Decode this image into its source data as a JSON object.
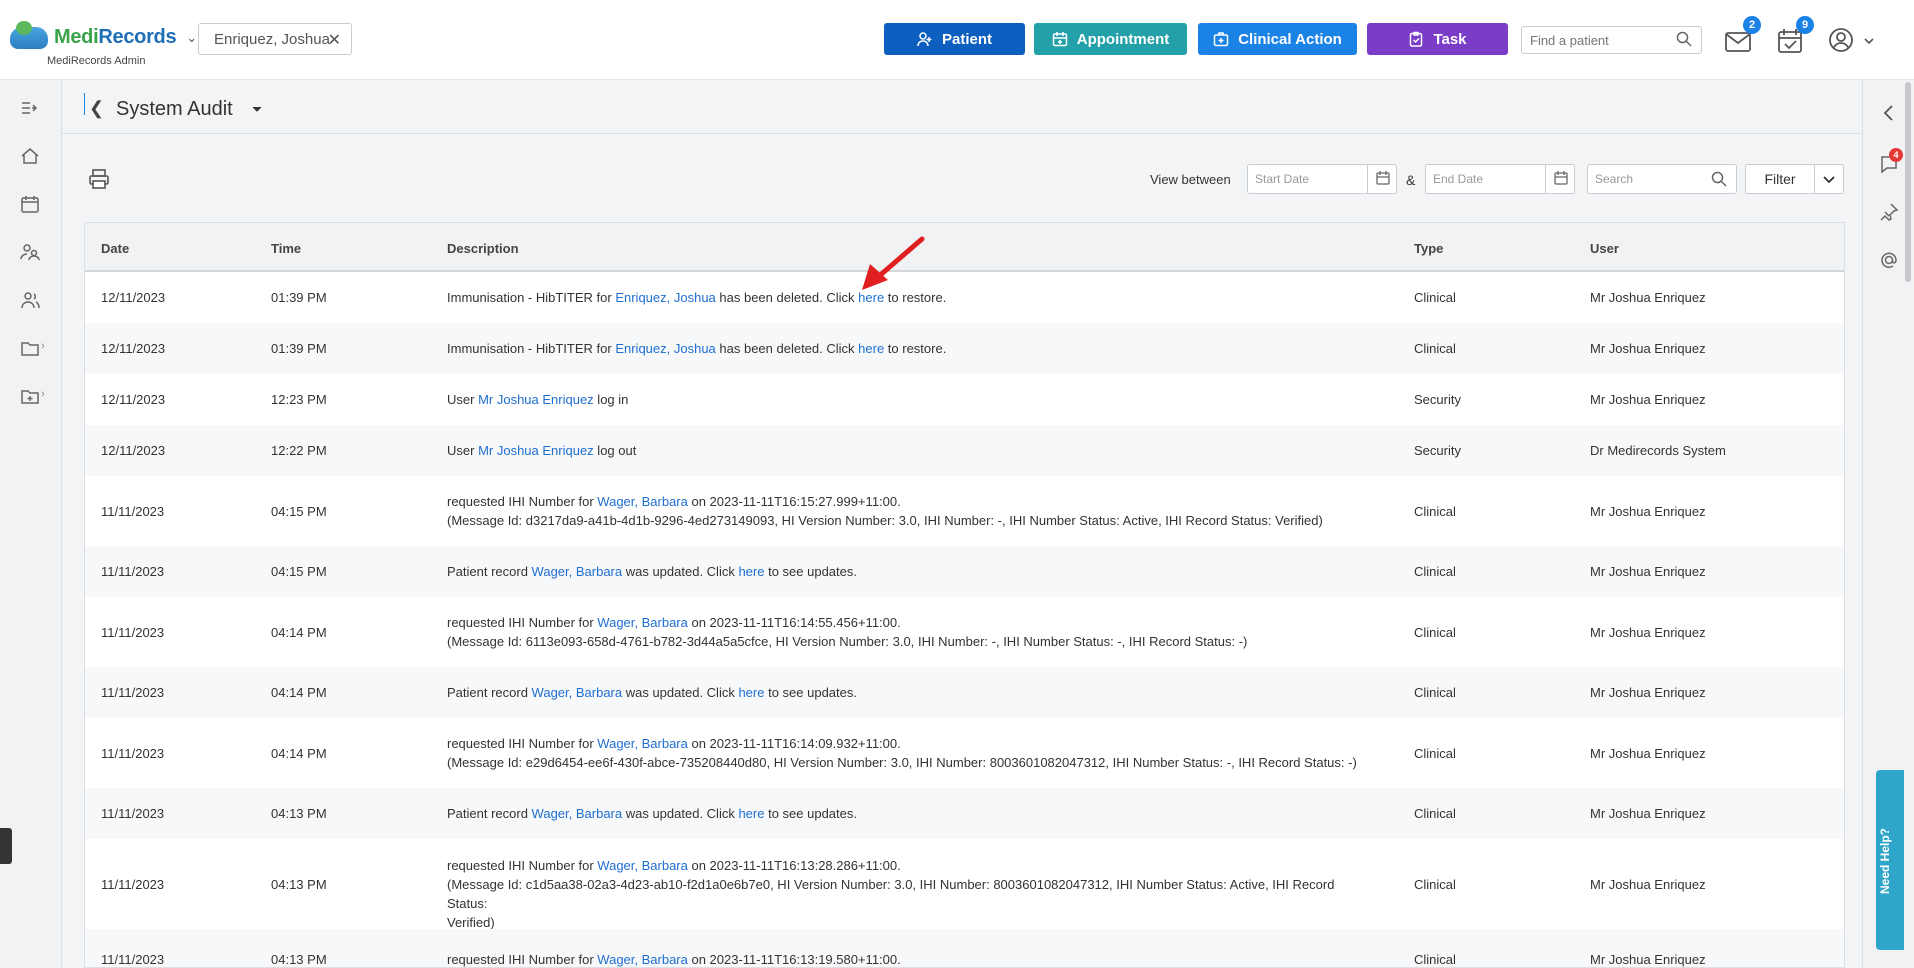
{
  "header": {
    "logo_medi": "Medi",
    "logo_records": "Records",
    "logo_sub": "MediRecords Admin",
    "patient_chip": "Enriquez, Joshua",
    "buttons": {
      "patient": "Patient",
      "appointment": "Appointment",
      "clinical_action": "Clinical Action",
      "task": "Task"
    },
    "find_placeholder": "Find a patient",
    "mail_badge": "2",
    "tasks_badge": "9",
    "colors": {
      "patient": "#0d5fbf",
      "appointment": "#23a0a8",
      "clinical_action": "#1b82e6",
      "task": "#7b3cc8"
    }
  },
  "page": {
    "title": "System Audit",
    "view_between": "View between",
    "start_placeholder": "Start Date",
    "end_placeholder": "End Date",
    "amp": "&",
    "search_placeholder": "Search",
    "filter_label": "Filter"
  },
  "right_sidebar": {
    "notifications_badge": "4",
    "need_help": "Need Help?"
  },
  "table": {
    "columns": [
      "Date",
      "Time",
      "Description",
      "Type",
      "User"
    ],
    "rows": [
      {
        "date": "12/11/2023",
        "time": "01:39 PM",
        "parts": [
          {
            "t": "Immunisation - HibTITER for "
          },
          {
            "t": "Enriquez, Joshua",
            "link": true
          },
          {
            "t": " has been deleted. Click "
          },
          {
            "t": "here",
            "link": true
          },
          {
            "t": " to restore."
          }
        ],
        "type": "Clinical",
        "user": "Mr Joshua Enriquez"
      },
      {
        "date": "12/11/2023",
        "time": "01:39 PM",
        "parts": [
          {
            "t": "Immunisation - HibTITER for "
          },
          {
            "t": "Enriquez, Joshua",
            "link": true
          },
          {
            "t": " has been deleted. Click "
          },
          {
            "t": "here",
            "link": true
          },
          {
            "t": " to restore."
          }
        ],
        "type": "Clinical",
        "user": "Mr Joshua Enriquez"
      },
      {
        "date": "12/11/2023",
        "time": "12:23 PM",
        "parts": [
          {
            "t": "User "
          },
          {
            "t": "Mr Joshua Enriquez",
            "link": true
          },
          {
            "t": " log in"
          }
        ],
        "type": "Security",
        "user": "Mr Joshua Enriquez"
      },
      {
        "date": "12/11/2023",
        "time": "12:22 PM",
        "parts": [
          {
            "t": "User "
          },
          {
            "t": "Mr Joshua Enriquez",
            "link": true
          },
          {
            "t": " log out"
          }
        ],
        "type": "Security",
        "user": "Dr Medirecords System"
      },
      {
        "date": "11/11/2023",
        "time": "04:15 PM",
        "parts": [
          {
            "t": "requested IHI Number for "
          },
          {
            "t": "Wager, Barbara",
            "link": true
          },
          {
            "t": " on 2023-11-11T16:15:27.999+11:00."
          },
          {
            "br": true
          },
          {
            "t": "(Message Id: d3217da9-a41b-4d1b-9296-4ed273149093, HI Version Number: 3.0, IHI Number: -, IHI Number Status: Active, IHI Record Status: Verified)"
          }
        ],
        "type": "Clinical",
        "user": "Mr Joshua Enriquez"
      },
      {
        "date": "11/11/2023",
        "time": "04:15 PM",
        "parts": [
          {
            "t": "Patient record "
          },
          {
            "t": "Wager, Barbara",
            "link": true
          },
          {
            "t": " was updated. Click "
          },
          {
            "t": "here",
            "link": true
          },
          {
            "t": " to see updates."
          }
        ],
        "type": "Clinical",
        "user": "Mr Joshua Enriquez"
      },
      {
        "date": "11/11/2023",
        "time": "04:14 PM",
        "parts": [
          {
            "t": "requested IHI Number for "
          },
          {
            "t": "Wager, Barbara",
            "link": true
          },
          {
            "t": " on 2023-11-11T16:14:55.456+11:00."
          },
          {
            "br": true
          },
          {
            "t": "(Message Id: 6113e093-658d-4761-b782-3d44a5a5cfce, HI Version Number: 3.0, IHI Number: -, IHI Number Status: -, IHI Record Status: -)"
          }
        ],
        "type": "Clinical",
        "user": "Mr Joshua Enriquez"
      },
      {
        "date": "11/11/2023",
        "time": "04:14 PM",
        "parts": [
          {
            "t": "Patient record "
          },
          {
            "t": "Wager, Barbara",
            "link": true
          },
          {
            "t": " was updated. Click "
          },
          {
            "t": "here",
            "link": true
          },
          {
            "t": " to see updates."
          }
        ],
        "type": "Clinical",
        "user": "Mr Joshua Enriquez"
      },
      {
        "date": "11/11/2023",
        "time": "04:14 PM",
        "parts": [
          {
            "t": "requested IHI Number for "
          },
          {
            "t": "Wager, Barbara",
            "link": true
          },
          {
            "t": " on 2023-11-11T16:14:09.932+11:00."
          },
          {
            "br": true
          },
          {
            "t": "(Message Id: e29d6454-ee6f-430f-abce-735208440d80, HI Version Number: 3.0, IHI Number: 8003601082047312, IHI Number Status: -, IHI Record Status: -)"
          }
        ],
        "type": "Clinical",
        "user": "Mr Joshua Enriquez"
      },
      {
        "date": "11/11/2023",
        "time": "04:13 PM",
        "parts": [
          {
            "t": "Patient record "
          },
          {
            "t": "Wager, Barbara",
            "link": true
          },
          {
            "t": " was updated. Click "
          },
          {
            "t": "here",
            "link": true
          },
          {
            "t": " to see updates."
          }
        ],
        "type": "Clinical",
        "user": "Mr Joshua Enriquez"
      },
      {
        "date": "11/11/2023",
        "time": "04:13 PM",
        "parts": [
          {
            "t": "requested IHI Number for "
          },
          {
            "t": "Wager, Barbara",
            "link": true
          },
          {
            "t": " on 2023-11-11T16:13:28.286+11:00."
          },
          {
            "br": true
          },
          {
            "t": "(Message Id: c1d5aa38-02a3-4d23-ab10-f2d1a0e6b7e0, HI Version Number: 3.0, IHI Number: 8003601082047312, IHI Number Status: Active, IHI Record Status:"
          },
          {
            "br": true
          },
          {
            "t": "Verified)"
          }
        ],
        "type": "Clinical",
        "user": "Mr Joshua Enriquez"
      },
      {
        "date": "11/11/2023",
        "time": "04:13 PM",
        "parts": [
          {
            "t": "requested IHI Number for "
          },
          {
            "t": "Wager, Barbara",
            "link": true
          },
          {
            "t": " on 2023-11-11T16:13:19.580+11:00."
          }
        ],
        "type": "Clinical",
        "user": "Mr Joshua Enriquez"
      }
    ]
  }
}
